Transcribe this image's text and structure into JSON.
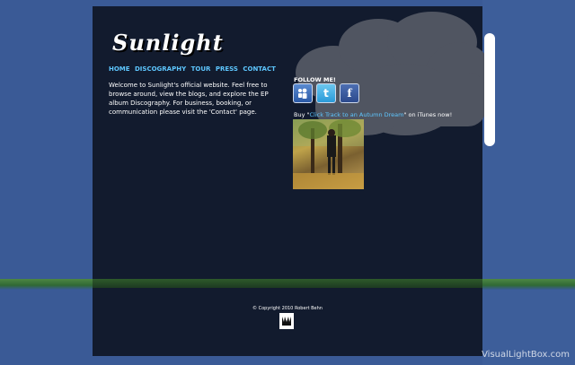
{
  "site": {
    "logo": "Sunlight"
  },
  "nav": [
    "HOME",
    "DISCOGRAPHY",
    "TOUR",
    "PRESS",
    "CONTACT"
  ],
  "intro": "Welcome to Sunlight's official website. Feel free to browse around, view the blogs, and explore the EP album Discography. For business, booking, or communication please visit the 'Contact' page.",
  "follow": {
    "label": "FOLLOW ME!",
    "icons": [
      "myspace-icon",
      "twitter-icon",
      "facebook-icon"
    ]
  },
  "buy": {
    "prefix": "Buy \"",
    "link": "Click Track to an Autumn Dream",
    "suffix": "\" on iTunes now!"
  },
  "footer": {
    "copyright": "© Copyright 2010 Robert Behn"
  },
  "watermark": "VisualLightBox.com",
  "colors": {
    "background": "#3a5a96",
    "panel": "#121b2e",
    "link": "#5ec7ff"
  }
}
